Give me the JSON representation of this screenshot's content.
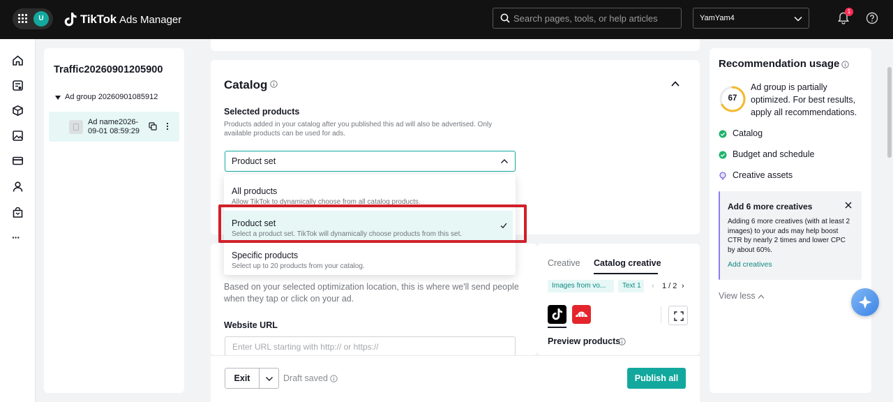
{
  "topbar": {
    "avatar_letter": "U",
    "brand_name": "TikTok",
    "brand_product": "Ads Manager",
    "search_placeholder": "Search pages, tools, or help articles",
    "account_name": "YamYam4",
    "notification_count": "1",
    "icons": [
      "apps-grid-icon",
      "tiktok-logo-icon",
      "search-icon",
      "chevron-down-icon",
      "bell-icon",
      "help-icon"
    ]
  },
  "rail": {
    "icons": [
      "home-icon",
      "campaign-icon",
      "catalog-box-icon",
      "creative-image-icon",
      "payment-card-icon",
      "user-icon",
      "shop-bag-icon",
      "more-dots-icon"
    ],
    "more_label": "···"
  },
  "tree": {
    "campaign_name": "Traffic20260901205900",
    "ad_group_name": "Ad group 20260901085912",
    "ad_name_line1": "Ad name2026-",
    "ad_name_line2": "09-01 08:59:29"
  },
  "catalog": {
    "title": "Catalog",
    "selected_products_label": "Selected products",
    "selected_products_desc": "Products added in your catalog after you published this ad will also be advertised. Only available products can be used for ads.",
    "select_value": "Product set",
    "options": [
      {
        "label": "All products",
        "desc": "Allow TikTok to dynamically choose from all catalog products.",
        "selected": false
      },
      {
        "label": "Product set",
        "desc": "Select a product set. TikTok will dynamically choose products from this set.",
        "selected": true
      },
      {
        "label": "Specific products",
        "desc": "Select up to 20 products from your catalog.",
        "selected": false
      }
    ],
    "highlight_color": "#d0202a"
  },
  "destination": {
    "desc": "Based on your selected optimization location, this is where we'll send people when they tap or click on your ad.",
    "website_url_label": "Website URL",
    "website_url_placeholder": "Enter URL starting with http:// or https://"
  },
  "preview": {
    "tab_creative": "Creative",
    "tab_catalog_creative": "Catalog creative",
    "chip_images": "Images from vo...",
    "chip_text": "Text 1",
    "page_prev": "‹",
    "pagination": "1 / 2",
    "page_next": "›",
    "preview_products_label": "Preview products"
  },
  "bottombar": {
    "exit_label": "Exit",
    "draft_status": "Draft saved",
    "publish_label": "Publish all"
  },
  "recommendation": {
    "title": "Recommendation usage",
    "score": "67",
    "score_fraction": 0.67,
    "desc": "Ad group is partially optimized. For best results, apply all recommendations.",
    "items": [
      {
        "label": "Catalog",
        "status": "done"
      },
      {
        "label": "Budget and schedule",
        "status": "done"
      },
      {
        "label": "Creative assets",
        "status": "tip"
      }
    ],
    "tip_title": "Add 6 more creatives",
    "tip_text": "Adding 6 more creatives (with at least 2 images) to your ads may help boost CTR by nearly 2 times and lower CPC by about 60%.",
    "tip_link": "Add creatives",
    "view_less": "View less"
  },
  "colors": {
    "brand_teal": "#13a89e",
    "topbar_bg": "#121212",
    "badge_red": "#fe2c55",
    "score_ring": "#f5b82e"
  }
}
